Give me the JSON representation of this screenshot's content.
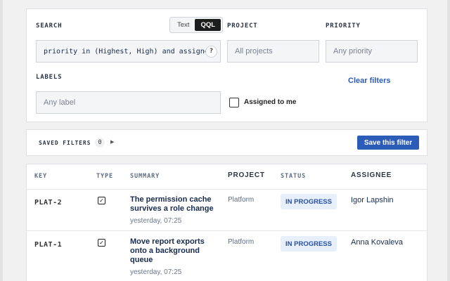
{
  "filters": {
    "search_label": "SEARCH",
    "mode_text": "Text",
    "mode_qql": "QQL",
    "query": "priority in (Highest, High) and assignee = currentUser()",
    "help_label": "?",
    "project_label": "PROJECT",
    "project_placeholder": "All projects",
    "priority_label": "PRIORITY",
    "priority_placeholder": "Any priority",
    "labels_label": "LABELS",
    "labels_placeholder": "Any label",
    "clear_label": "Clear filters",
    "assigned_label": "Assigned to me",
    "assigned_checked": false
  },
  "saved": {
    "label": "SAVED FILTERS",
    "count": "0",
    "save_button": "Save this filter"
  },
  "table": {
    "headers": {
      "key": "KEY",
      "type": "TYPE",
      "summary": "SUMMARY",
      "project": "PROJECT",
      "status": "STATUS",
      "assignee": "ASSIGNEE"
    },
    "rows": [
      {
        "key": "PLAT-2",
        "type_icon": "task-checkbox-icon",
        "summary": "The permission cache survives a role change",
        "time": "yesterday, 07:25",
        "project": "Platform",
        "status": "IN PROGRESS",
        "assignee": "Igor Lapshin"
      },
      {
        "key": "PLAT-1",
        "type_icon": "task-checkbox-icon",
        "summary": "Move report exports onto a background queue",
        "time": "yesterday, 07:25",
        "project": "Platform",
        "status": "IN PROGRESS",
        "assignee": "Anna Kovaleva"
      }
    ]
  }
}
